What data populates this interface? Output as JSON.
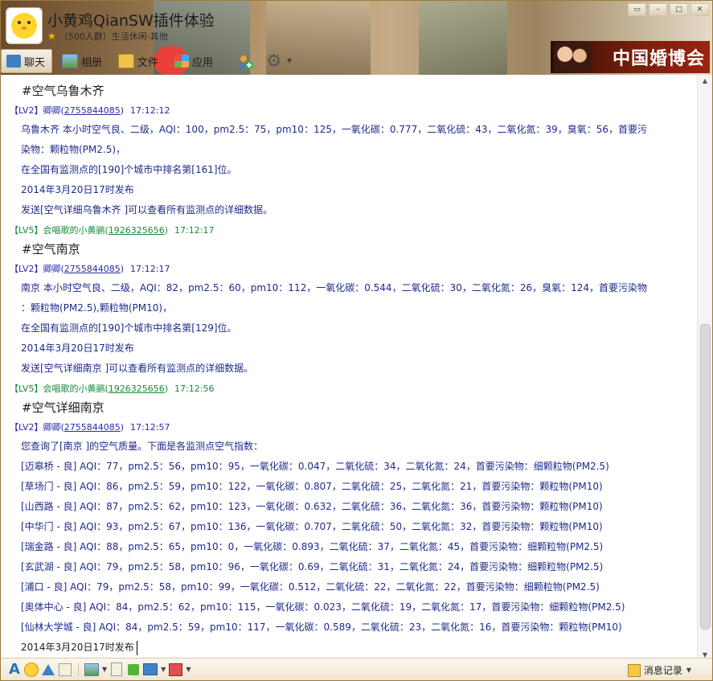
{
  "window": {
    "title": "小黄鸡QianSW插件体验",
    "subtitle": "（500人群）生活休闲-其他",
    "controls": [
      "▭",
      "–",
      "□",
      "✕"
    ]
  },
  "nav": {
    "tabs": [
      {
        "label": "聊天",
        "icon": "chat-icon"
      },
      {
        "label": "相册",
        "icon": "album-icon"
      },
      {
        "label": "文件",
        "icon": "file-icon"
      },
      {
        "label": "应用",
        "icon": "app-icon"
      }
    ]
  },
  "ad": {
    "text": "中国婚博会"
  },
  "messages": [
    {
      "cmd": "#空气乌鲁木齐",
      "level": "【LV2】",
      "name": "卿卿",
      "uid": "2755844085",
      "time": "17:12:12",
      "lines": [
        "乌鲁木齐 本小时空气良、二级，AQI：100，pm2.5：75，pm10：125，一氧化碳：0.777，二氧化硫：43，二氧化氮：39，臭氧：56，首要污",
        "染物：颗粒物(PM2.5)，",
        "在全国有监测点的[190]个城市中排名第[161]位。",
        "2014年3月20日17时发布",
        "发送[空气详细乌鲁木齐 ]可以查看所有监测点的详细数据。"
      ]
    },
    {
      "level": "【LV5】",
      "name": "会唱歌的小黄鹂",
      "uid": "1926325656",
      "time": "17:12:17",
      "cmd": "#空气南京",
      "reply": {
        "level": "【LV2】",
        "name": "卿卿",
        "uid": "2755844085",
        "time": "17:12:17",
        "lines": [
          "南京 本小时空气良、二级，AQI：82，pm2.5：60，pm10：112，一氧化碳：0.544，二氧化硫：30，二氧化氮：26，臭氧：124，首要污染物",
          "：颗粒物(PM2.5),颗粒物(PM10)，",
          "在全国有监测点的[190]个城市中排名第[129]位。",
          "2014年3月20日17时发布",
          "发送[空气详细南京 ]可以查看所有监测点的详细数据。"
        ]
      }
    },
    {
      "level": "【LV5】",
      "name": "会唱歌的小黄鹂",
      "uid": "1926325656",
      "time": "17:12:56",
      "cmd": "#空气详细南京",
      "reply": {
        "level": "【LV2】",
        "name": "卿卿",
        "uid": "2755844085",
        "time": "17:12:57",
        "lines": [
          "您查询了[南京 ]的空气质量。下面是各监测点空气指数：",
          "[迈皋桥 - 良] AQI：77，pm2.5：56，pm10：95，一氧化碳：0.047，二氧化硫：34，二氧化氮：24，首要污染物：细颗粒物(PM2.5)",
          "[草场门 - 良] AQI：86，pm2.5：59，pm10：122，一氧化碳：0.807，二氧化硫：25，二氧化氮：21，首要污染物：颗粒物(PM10)",
          "[山西路 - 良] AQI：87，pm2.5：62，pm10：123，一氧化碳：0.632，二氧化硫：36，二氧化氮：36，首要污染物：颗粒物(PM10)",
          "[中华门 - 良] AQI：93，pm2.5：67，pm10：136，一氧化碳：0.707，二氧化硫：50，二氧化氮：32，首要污染物：颗粒物(PM10)",
          "[瑞金路 - 良] AQI：88，pm2.5：65，pm10：0，一氧化碳：0.893，二氧化硫：37，二氧化氮：45，首要污染物：细颗粒物(PM2.5)",
          "[玄武湖 - 良] AQI：79，pm2.5：58，pm10：96，一氧化碳：0.69，二氧化硫：31，二氧化氮：24，首要污染物：细颗粒物(PM2.5)",
          "[浦口 - 良] AQI：79，pm2.5：58，pm10：99，一氧化碳：0.512，二氧化硫：22，二氧化氮：22，首要污染物：细颗粒物(PM2.5)",
          "[奥体中心 - 良] AQI：84，pm2.5：62，pm10：115，一氧化碳：0.023，二氧化硫：19，二氧化氮：17，首要污染物：细颗粒物(PM2.5)",
          "[仙林大学城 - 良] AQI：84，pm2.5：59，pm10：117，一氧化碳：0.589，二氧化硫：23，二氧化氮：16，首要污染物：颗粒物(PM10)",
          "2014年3月20日17时发布"
        ]
      }
    }
  ],
  "toolbar": {
    "history_label": "消息记录"
  },
  "colors": {
    "lv2": "#2a2aa8",
    "lv5": "#168a3a",
    "message_text": "#1e2a8a"
  }
}
